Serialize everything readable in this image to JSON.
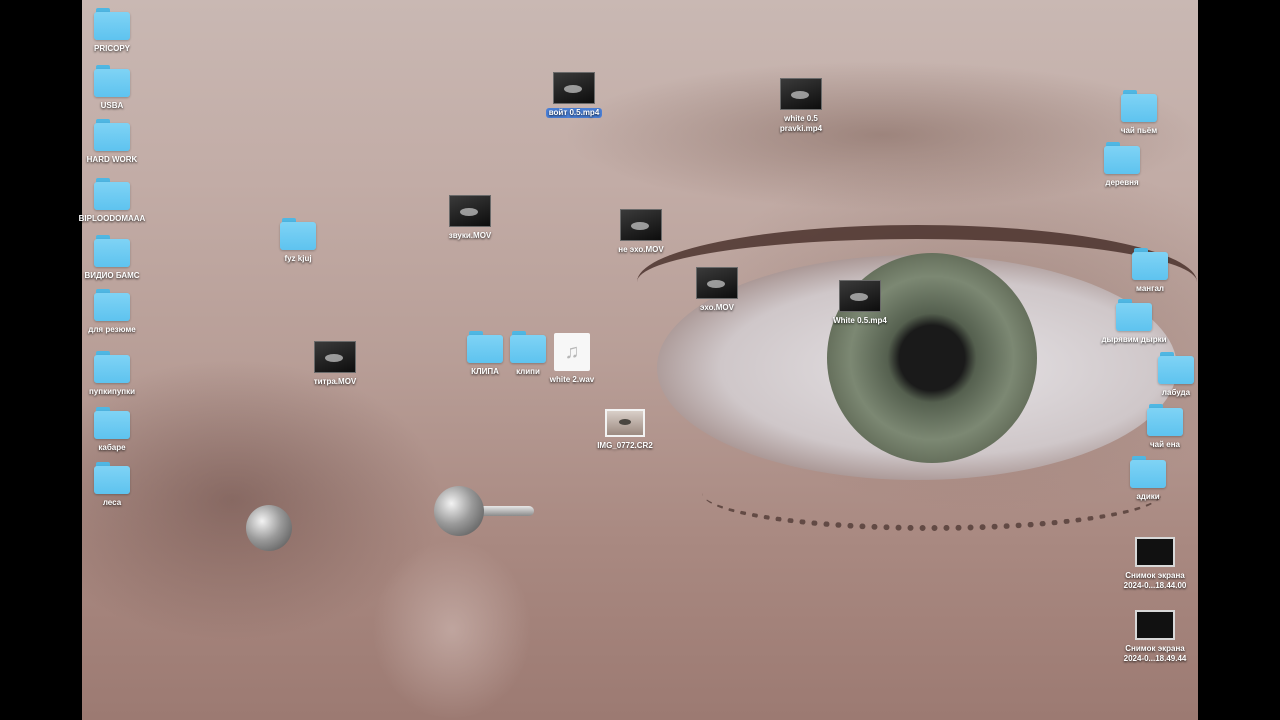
{
  "desktop": {
    "left_icons": [
      {
        "label": "PRICOPY",
        "type": "folder"
      },
      {
        "label": "USBA",
        "type": "folder"
      },
      {
        "label": "HARD WORK",
        "type": "folder"
      },
      {
        "label": "BIPLOODOMAAA",
        "type": "folder"
      },
      {
        "label": "ВИДИО БАМС",
        "type": "folder"
      },
      {
        "label": "для резюме",
        "type": "folder"
      },
      {
        "label": "пупкипупки",
        "type": "folder"
      },
      {
        "label": "кабаре",
        "type": "folder"
      },
      {
        "label": "леса",
        "type": "folder"
      }
    ],
    "center_icons": [
      {
        "label": "войт 0.5.mp4",
        "type": "video",
        "selected": true
      },
      {
        "label": "white 0.5\npravki.mp4",
        "type": "video"
      },
      {
        "label": "fyz kjuj",
        "type": "folder"
      },
      {
        "label": "звуки.MOV",
        "type": "video"
      },
      {
        "label": "не эхо.MOV",
        "type": "video"
      },
      {
        "label": "эхо.MOV",
        "type": "video"
      },
      {
        "label": "White 0.5.mp4",
        "type": "video"
      },
      {
        "label": "титра.MOV",
        "type": "video"
      },
      {
        "label": "КЛИПА",
        "type": "folder"
      },
      {
        "label": "клипи",
        "type": "folder"
      },
      {
        "label": "white 2.wav",
        "type": "audio"
      },
      {
        "label": "IMG_0772.CR2",
        "type": "photo"
      }
    ],
    "right_icons": [
      {
        "label": "чай пьём",
        "type": "folder"
      },
      {
        "label": "деревня",
        "type": "folder"
      },
      {
        "label": "мангал",
        "type": "folder"
      },
      {
        "label": "дырявим дырки",
        "type": "folder"
      },
      {
        "label": "лабуда",
        "type": "folder"
      },
      {
        "label": "чай ена",
        "type": "folder"
      },
      {
        "label": "адики",
        "type": "folder"
      },
      {
        "label": "Снимок экрана\n2024-0...18.44.00",
        "type": "screenshot"
      },
      {
        "label": "Снимок экрана\n2024-0...18.49.44",
        "type": "screenshot"
      }
    ],
    "audio_glyph": "♫",
    "folder_color": "#5ec3ef",
    "selection_color": "#4a7fd6"
  }
}
